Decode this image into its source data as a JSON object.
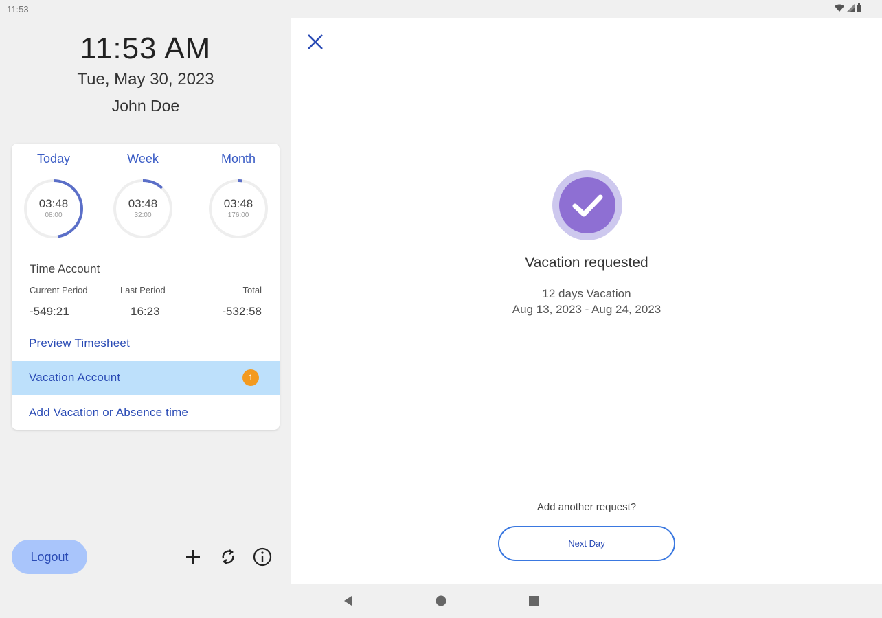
{
  "status_bar": {
    "time": "11:53",
    "icons": [
      "wifi-icon",
      "signal-icon",
      "battery-icon"
    ]
  },
  "header": {
    "time": "11:53 AM",
    "date": "Tue, May 30, 2023",
    "user": "John Doe"
  },
  "summary": {
    "rings": [
      {
        "label": "Today",
        "value": "03:48",
        "target": "08:00",
        "progress": 0.475
      },
      {
        "label": "Week",
        "value": "03:48",
        "target": "32:00",
        "progress": 0.119
      },
      {
        "label": "Month",
        "value": "03:48",
        "target": "176:00",
        "progress": 0.022
      }
    ],
    "time_account": {
      "title": "Time Account",
      "columns": [
        {
          "heading": "Current Period",
          "value": "-549:21"
        },
        {
          "heading": "Last Period",
          "value": "16:23"
        },
        {
          "heading": "Total",
          "value": "-532:58"
        }
      ]
    },
    "links": {
      "preview_timesheet": "Preview Timesheet",
      "vacation_account": "Vacation Account",
      "vacation_badge": "1",
      "add_vacation": "Add Vacation or Absence time"
    }
  },
  "footer": {
    "logout_label": "Logout",
    "icons": [
      "add-icon",
      "sync-icon",
      "info-icon"
    ]
  },
  "result": {
    "title": "Vacation requested",
    "detail_line1": "12 days Vacation",
    "detail_line2": "Aug 13, 2023 - Aug 24, 2023",
    "prompt": "Add another request?",
    "next_button": "Next Day"
  },
  "colors": {
    "accent": "#3a5cc5",
    "ring_progress": "#5b6fc8",
    "ring_track": "#eeeeee",
    "check_outer": "#cdc8ee",
    "check_inner": "#8e6fd3",
    "badge": "#f39a1f",
    "active_row": "#bde0fb",
    "logout_bg": "#a9c5fb"
  }
}
